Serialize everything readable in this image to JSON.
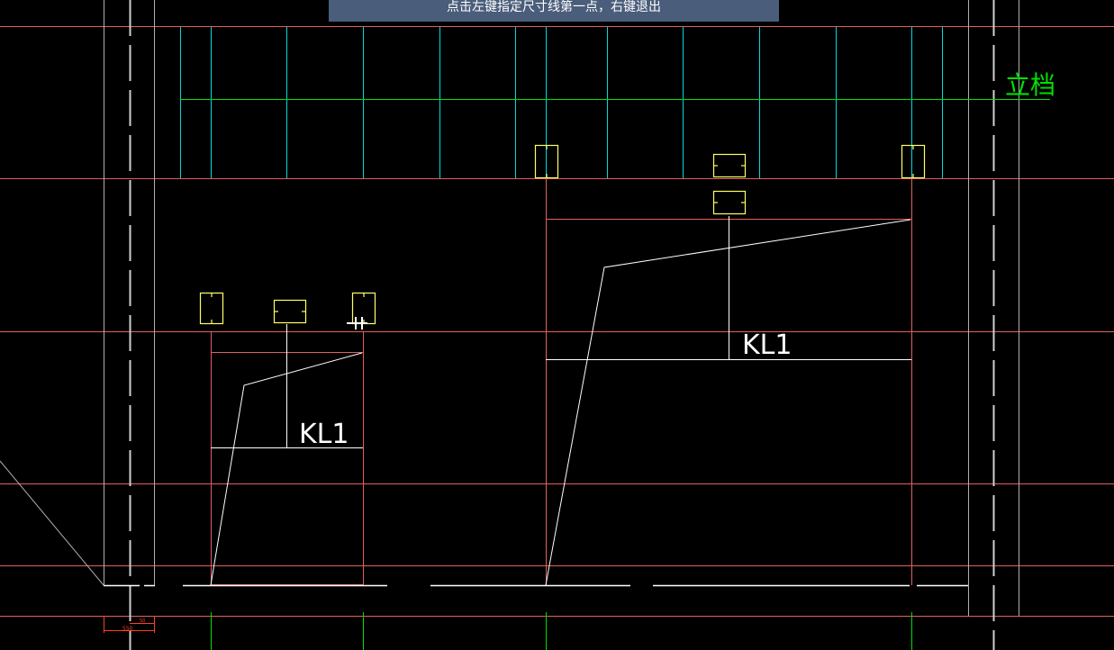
{
  "prompt": {
    "text": "点击左键指定尺寸线第一点，右键退出"
  },
  "labels": {
    "standing_bar": "立档",
    "beam_small": "KL1",
    "beam_large": "KL1",
    "dim_left": "550",
    "dim_small": "50"
  },
  "colors": {
    "background": "#000000",
    "red_line": "#e06060",
    "cyan_line": "#00d8e0",
    "green_line": "#00e000",
    "white_line": "#ffffff",
    "yellow_symbol": "#ffff66",
    "grey_line": "#b0b0b0",
    "orange_dim": "#ff4020",
    "banner": "#4a5d7a"
  }
}
